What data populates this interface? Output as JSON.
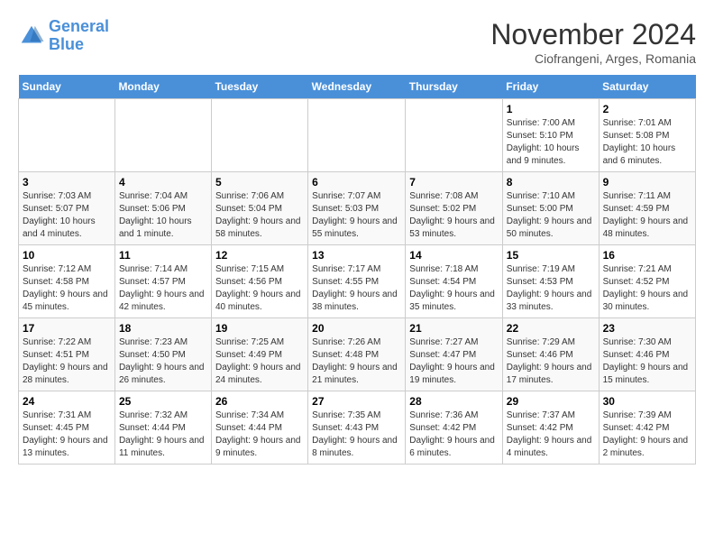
{
  "header": {
    "logo_line1": "General",
    "logo_line2": "Blue",
    "month_title": "November 2024",
    "subtitle": "Ciofrangeni, Arges, Romania"
  },
  "days_of_week": [
    "Sunday",
    "Monday",
    "Tuesday",
    "Wednesday",
    "Thursday",
    "Friday",
    "Saturday"
  ],
  "weeks": [
    [
      {
        "day": "",
        "info": ""
      },
      {
        "day": "",
        "info": ""
      },
      {
        "day": "",
        "info": ""
      },
      {
        "day": "",
        "info": ""
      },
      {
        "day": "",
        "info": ""
      },
      {
        "day": "1",
        "info": "Sunrise: 7:00 AM\nSunset: 5:10 PM\nDaylight: 10 hours and 9 minutes."
      },
      {
        "day": "2",
        "info": "Sunrise: 7:01 AM\nSunset: 5:08 PM\nDaylight: 10 hours and 6 minutes."
      }
    ],
    [
      {
        "day": "3",
        "info": "Sunrise: 7:03 AM\nSunset: 5:07 PM\nDaylight: 10 hours and 4 minutes."
      },
      {
        "day": "4",
        "info": "Sunrise: 7:04 AM\nSunset: 5:06 PM\nDaylight: 10 hours and 1 minute."
      },
      {
        "day": "5",
        "info": "Sunrise: 7:06 AM\nSunset: 5:04 PM\nDaylight: 9 hours and 58 minutes."
      },
      {
        "day": "6",
        "info": "Sunrise: 7:07 AM\nSunset: 5:03 PM\nDaylight: 9 hours and 55 minutes."
      },
      {
        "day": "7",
        "info": "Sunrise: 7:08 AM\nSunset: 5:02 PM\nDaylight: 9 hours and 53 minutes."
      },
      {
        "day": "8",
        "info": "Sunrise: 7:10 AM\nSunset: 5:00 PM\nDaylight: 9 hours and 50 minutes."
      },
      {
        "day": "9",
        "info": "Sunrise: 7:11 AM\nSunset: 4:59 PM\nDaylight: 9 hours and 48 minutes."
      }
    ],
    [
      {
        "day": "10",
        "info": "Sunrise: 7:12 AM\nSunset: 4:58 PM\nDaylight: 9 hours and 45 minutes."
      },
      {
        "day": "11",
        "info": "Sunrise: 7:14 AM\nSunset: 4:57 PM\nDaylight: 9 hours and 42 minutes."
      },
      {
        "day": "12",
        "info": "Sunrise: 7:15 AM\nSunset: 4:56 PM\nDaylight: 9 hours and 40 minutes."
      },
      {
        "day": "13",
        "info": "Sunrise: 7:17 AM\nSunset: 4:55 PM\nDaylight: 9 hours and 38 minutes."
      },
      {
        "day": "14",
        "info": "Sunrise: 7:18 AM\nSunset: 4:54 PM\nDaylight: 9 hours and 35 minutes."
      },
      {
        "day": "15",
        "info": "Sunrise: 7:19 AM\nSunset: 4:53 PM\nDaylight: 9 hours and 33 minutes."
      },
      {
        "day": "16",
        "info": "Sunrise: 7:21 AM\nSunset: 4:52 PM\nDaylight: 9 hours and 30 minutes."
      }
    ],
    [
      {
        "day": "17",
        "info": "Sunrise: 7:22 AM\nSunset: 4:51 PM\nDaylight: 9 hours and 28 minutes."
      },
      {
        "day": "18",
        "info": "Sunrise: 7:23 AM\nSunset: 4:50 PM\nDaylight: 9 hours and 26 minutes."
      },
      {
        "day": "19",
        "info": "Sunrise: 7:25 AM\nSunset: 4:49 PM\nDaylight: 9 hours and 24 minutes."
      },
      {
        "day": "20",
        "info": "Sunrise: 7:26 AM\nSunset: 4:48 PM\nDaylight: 9 hours and 21 minutes."
      },
      {
        "day": "21",
        "info": "Sunrise: 7:27 AM\nSunset: 4:47 PM\nDaylight: 9 hours and 19 minutes."
      },
      {
        "day": "22",
        "info": "Sunrise: 7:29 AM\nSunset: 4:46 PM\nDaylight: 9 hours and 17 minutes."
      },
      {
        "day": "23",
        "info": "Sunrise: 7:30 AM\nSunset: 4:46 PM\nDaylight: 9 hours and 15 minutes."
      }
    ],
    [
      {
        "day": "24",
        "info": "Sunrise: 7:31 AM\nSunset: 4:45 PM\nDaylight: 9 hours and 13 minutes."
      },
      {
        "day": "25",
        "info": "Sunrise: 7:32 AM\nSunset: 4:44 PM\nDaylight: 9 hours and 11 minutes."
      },
      {
        "day": "26",
        "info": "Sunrise: 7:34 AM\nSunset: 4:44 PM\nDaylight: 9 hours and 9 minutes."
      },
      {
        "day": "27",
        "info": "Sunrise: 7:35 AM\nSunset: 4:43 PM\nDaylight: 9 hours and 8 minutes."
      },
      {
        "day": "28",
        "info": "Sunrise: 7:36 AM\nSunset: 4:42 PM\nDaylight: 9 hours and 6 minutes."
      },
      {
        "day": "29",
        "info": "Sunrise: 7:37 AM\nSunset: 4:42 PM\nDaylight: 9 hours and 4 minutes."
      },
      {
        "day": "30",
        "info": "Sunrise: 7:39 AM\nSunset: 4:42 PM\nDaylight: 9 hours and 2 minutes."
      }
    ]
  ]
}
